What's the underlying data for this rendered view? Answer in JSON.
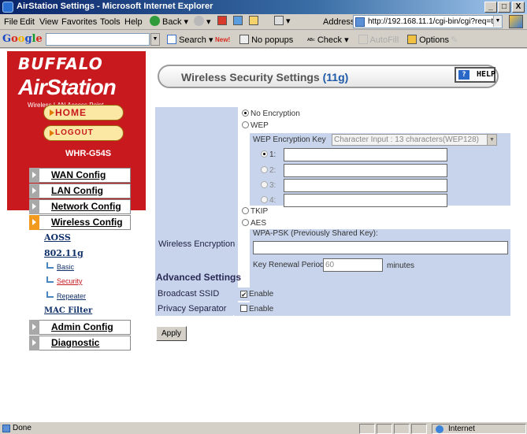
{
  "window": {
    "title": "AirStation Settings - Microsoft Internet Explorer",
    "controls": [
      "_",
      "□",
      "X"
    ]
  },
  "menu": [
    "File",
    "Edit",
    "View",
    "Favorites",
    "Tools",
    "Help"
  ],
  "toolbar": {
    "back_label": "Back",
    "address_label": "Address",
    "address_url": "http://192.168.11.1/cgi-bin/cgi?req=tfr&"
  },
  "google_bar": {
    "logo": "Google",
    "search_label": "Search",
    "new_badge": "New!",
    "popups_label": "No popups",
    "check_label": "Check",
    "autofill_label": "AutoFill",
    "options_label": "Options"
  },
  "sidebar": {
    "brand": "BUFFALO",
    "product": "AirStation",
    "subtitle": "Wireless LAN Access Point",
    "home_label": "HOME",
    "logout_label": "LOGOUT",
    "model": "WHR-G54S",
    "menu": [
      {
        "label": "WAN Config",
        "active": false
      },
      {
        "label": "LAN Config",
        "active": false
      },
      {
        "label": "Network Config",
        "active": false
      },
      {
        "label": "Wireless Config",
        "active": true
      }
    ],
    "wireless_sub": {
      "aoss": "AOSS",
      "band": "802.11g",
      "basic": "Basic",
      "security": "Security",
      "repeater": "Repeater",
      "mac_filter": "MAC Filter"
    },
    "menu_bottom": [
      {
        "label": "Admin Config"
      },
      {
        "label": "Diagnostic"
      }
    ]
  },
  "main": {
    "title_prefix": "Wireless Security Settings",
    "title_band": "(11g)",
    "help_label": "HELP",
    "encryption": {
      "label": "Wireless Encryption",
      "no_encryption": "No Encryption",
      "wep": "WEP",
      "wep_key_label": "WEP Encryption Key",
      "wep_key_type": "Character Input : 13 characters(WEP128)",
      "key_labels": [
        "1:",
        "2:",
        "3:",
        "4:"
      ],
      "tkip": "TKIP",
      "aes": "AES",
      "wpa_psk_label": "WPA-PSK (Previously Shared Key):",
      "key_renewal_label": "Key Renewal Period :",
      "key_renewal_value": "60",
      "key_renewal_unit": "minutes"
    },
    "advanced": {
      "title": "Advanced Settings",
      "broadcast_ssid_label": "Broadcast SSID",
      "broadcast_ssid_value": "Enable",
      "broadcast_ssid_checked": true,
      "privacy_sep_label": "Privacy Separator",
      "privacy_sep_value": "Enable",
      "privacy_sep_checked": false
    },
    "apply_label": "Apply"
  },
  "status": {
    "text": "Done",
    "zone": "Internet"
  }
}
